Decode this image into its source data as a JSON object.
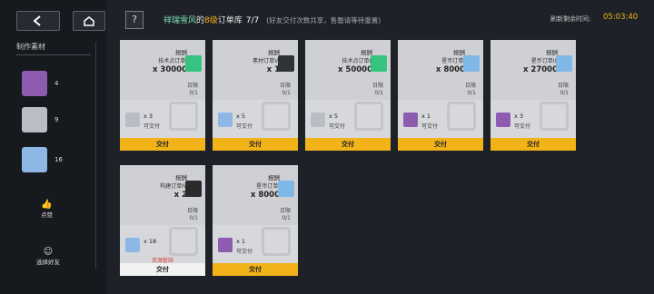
{
  "sidebar": {
    "section_label": "制作素材",
    "materials": [
      {
        "icon": "purple-orb-icon",
        "count": "4",
        "color": "#8d5cb1"
      },
      {
        "icon": "film-card-icon",
        "count": "9",
        "color": "#b9bec6"
      },
      {
        "icon": "blue-cube-icon",
        "count": "16",
        "color": "#8fb7e6"
      }
    ],
    "like_label": "点赞",
    "invite_label": "选择好友"
  },
  "header": {
    "name": "祥瑞雪风",
    "mid": "的",
    "level": "8级",
    "suffix": "订单库",
    "count": "7/7",
    "note": "(好友交付次数共享，售罄请等待重置)",
    "timer_label": "刷新剩余时间:",
    "timer": "05:03:40"
  },
  "cards": [
    {
      "reward": "报酬",
      "sub": "技术点订单I",
      "amount": "x 30000",
      "ticket_color": "#34c47f",
      "deadline": "日限",
      "deadline_val": "0/1",
      "req_icon": "film-card-icon",
      "req_color": "#b9bec6",
      "req_qty": "x 3",
      "req_status": "可交付",
      "button": "交付",
      "enabled": true
    },
    {
      "reward": "报酬",
      "sub": "素材订单VI",
      "amount": "x 1",
      "ticket_color": "#2f3338",
      "deadline": "日限",
      "deadline_val": "0/1",
      "req_icon": "blue-cube-icon",
      "req_color": "#8fb7e6",
      "req_qty": "x 5",
      "req_status": "可交付",
      "button": "交付",
      "enabled": true
    },
    {
      "reward": "报酬",
      "sub": "技术点订单II",
      "amount": "x 50000",
      "ticket_color": "#34c47f",
      "deadline": "日限",
      "deadline_val": "0/1",
      "req_icon": "film-card-icon",
      "req_color": "#b9bec6",
      "req_qty": "x 5",
      "req_status": "可交付",
      "button": "交付",
      "enabled": true
    },
    {
      "reward": "报酬",
      "sub": "星币订单I",
      "amount": "x 8000",
      "ticket_color": "#7fb7e6",
      "deadline": "日限",
      "deadline_val": "0/1",
      "req_icon": "purple-orb-icon",
      "req_color": "#8d5cb1",
      "req_qty": "x 1",
      "req_status": "可交付",
      "button": "交付",
      "enabled": true
    },
    {
      "reward": "报酬",
      "sub": "星币订单III",
      "amount": "x 27000",
      "ticket_color": "#7fb7e6",
      "deadline": "日限",
      "deadline_val": "0/1",
      "req_icon": "purple-orb-icon",
      "req_color": "#8d5cb1",
      "req_qty": "x 3",
      "req_status": "可交付",
      "button": "交付",
      "enabled": true
    },
    {
      "reward": "报酬",
      "sub": "构建订单IV",
      "amount": "x 2",
      "ticket_color": "#2b2b2b",
      "deadline": "日限",
      "deadline_val": "0/1",
      "req_icon": "blue-cube-icon",
      "req_color": "#8fb7e6",
      "req_qty": "x 18",
      "req_status": "资源暂缺",
      "button": "交付",
      "enabled": false
    },
    {
      "reward": "报酬",
      "sub": "星币订单I",
      "amount": "x 8000",
      "ticket_color": "#7fb7e6",
      "deadline": "日限",
      "deadline_val": "0/1",
      "req_icon": "purple-orb-icon",
      "req_color": "#8d5cb1",
      "req_qty": "x 1",
      "req_status": "可交付",
      "button": "交付",
      "enabled": true
    }
  ]
}
